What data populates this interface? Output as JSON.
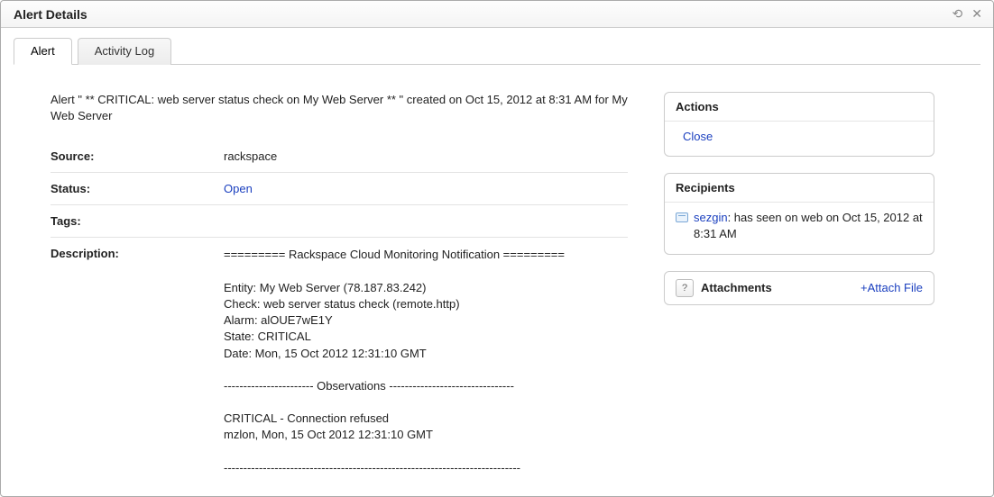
{
  "window": {
    "title": "Alert Details"
  },
  "tabs": {
    "alert": "Alert",
    "activity": "Activity Log"
  },
  "summary": "Alert \" ** CRITICAL: web server status check on My Web Server ** \" created on Oct 15, 2012 at 8:31 AM for My Web Server",
  "fields": {
    "source_label": "Source:",
    "source_value": "rackspace",
    "status_label": "Status:",
    "status_value": "Open",
    "tags_label": "Tags:",
    "tags_value": "",
    "description_label": "Description:",
    "description_value": "========= Rackspace Cloud Monitoring Notification =========\n\nEntity: My Web Server (78.187.83.242)\nCheck: web server status check (remote.http)\nAlarm: alOUE7wE1Y\nState: CRITICAL\nDate: Mon, 15 Oct 2012 12:31:10 GMT\n\n----------------------- Observations --------------------------------\n\nCRITICAL - Connection refused\nmzlon, Mon, 15 Oct 2012 12:31:10 GMT\n\n----------------------------------------------------------------------------"
  },
  "actions": {
    "title": "Actions",
    "close": "Close"
  },
  "recipients": {
    "title": "Recipients",
    "name": "sezgin",
    "rest": ": has seen on web on Oct 15, 2012 at 8:31 AM"
  },
  "attachments": {
    "title": "Attachments",
    "link": "+Attach File",
    "help": "?"
  }
}
